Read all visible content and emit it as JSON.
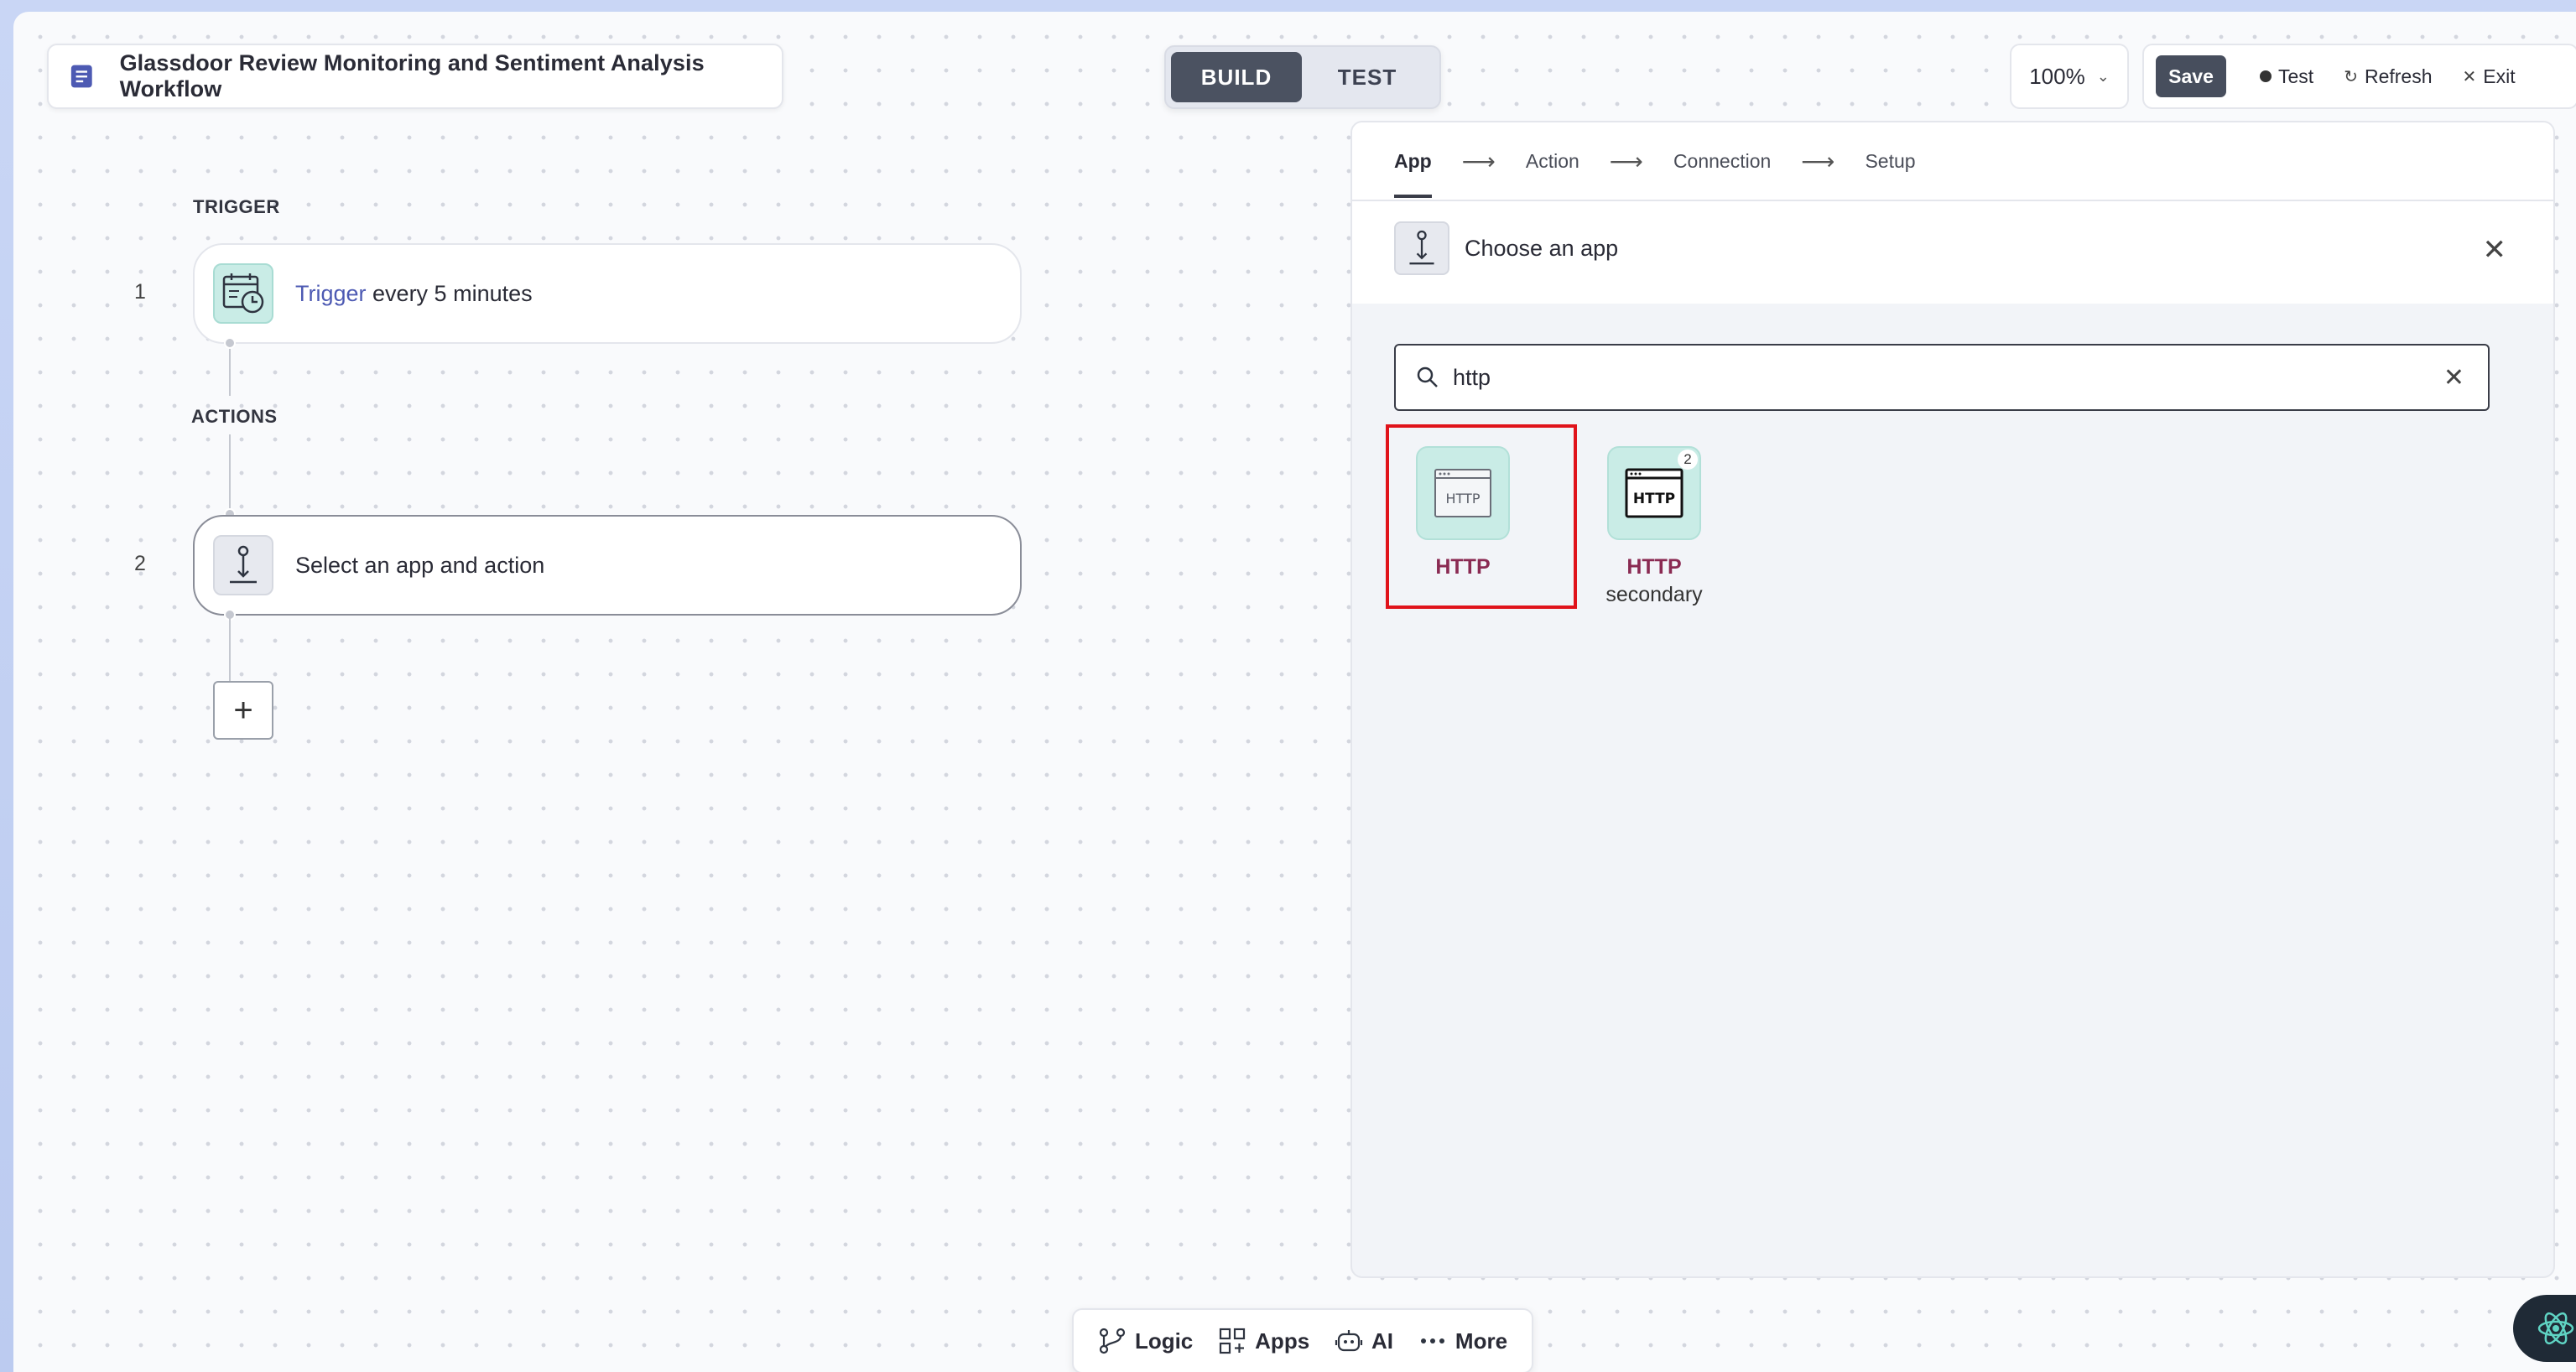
{
  "header": {
    "workflow_title": "Glassdoor Review Monitoring and Sentiment Analysis Workflow",
    "mode_build": "BUILD",
    "mode_test": "TEST",
    "zoom": "100%",
    "save_label": "Save",
    "test_label": "Test",
    "refresh_label": "Refresh",
    "exit_label": "Exit"
  },
  "workflow": {
    "trigger_section": "TRIGGER",
    "actions_section": "ACTIONS",
    "steps": [
      {
        "number": "1",
        "link": "Trigger",
        "text": " every 5 minutes"
      },
      {
        "number": "2",
        "text": "Select an app and action"
      }
    ],
    "add_label": "+"
  },
  "panel": {
    "nav": [
      "App",
      "Action",
      "Connection",
      "Setup"
    ],
    "active_nav": "App",
    "choose_title": "Choose an app",
    "search": {
      "value": "http",
      "placeholder": ""
    },
    "apps": [
      {
        "icon_text": "HTTP",
        "label": "HTTP",
        "sub": "",
        "selected": true
      },
      {
        "icon_text": "HTTP",
        "label": "HTTP",
        "sub": "secondary",
        "badge": "2"
      }
    ]
  },
  "bottom_bar": {
    "logic": "Logic",
    "apps": "Apps",
    "ai": "AI",
    "more": "More"
  },
  "colors": {
    "accent_dark": "#4b5261",
    "app_tile_bg": "#c9ece6",
    "app_label": "#8a2a52",
    "highlight": "#e0131b",
    "trigger_link": "#4d5ab3"
  }
}
